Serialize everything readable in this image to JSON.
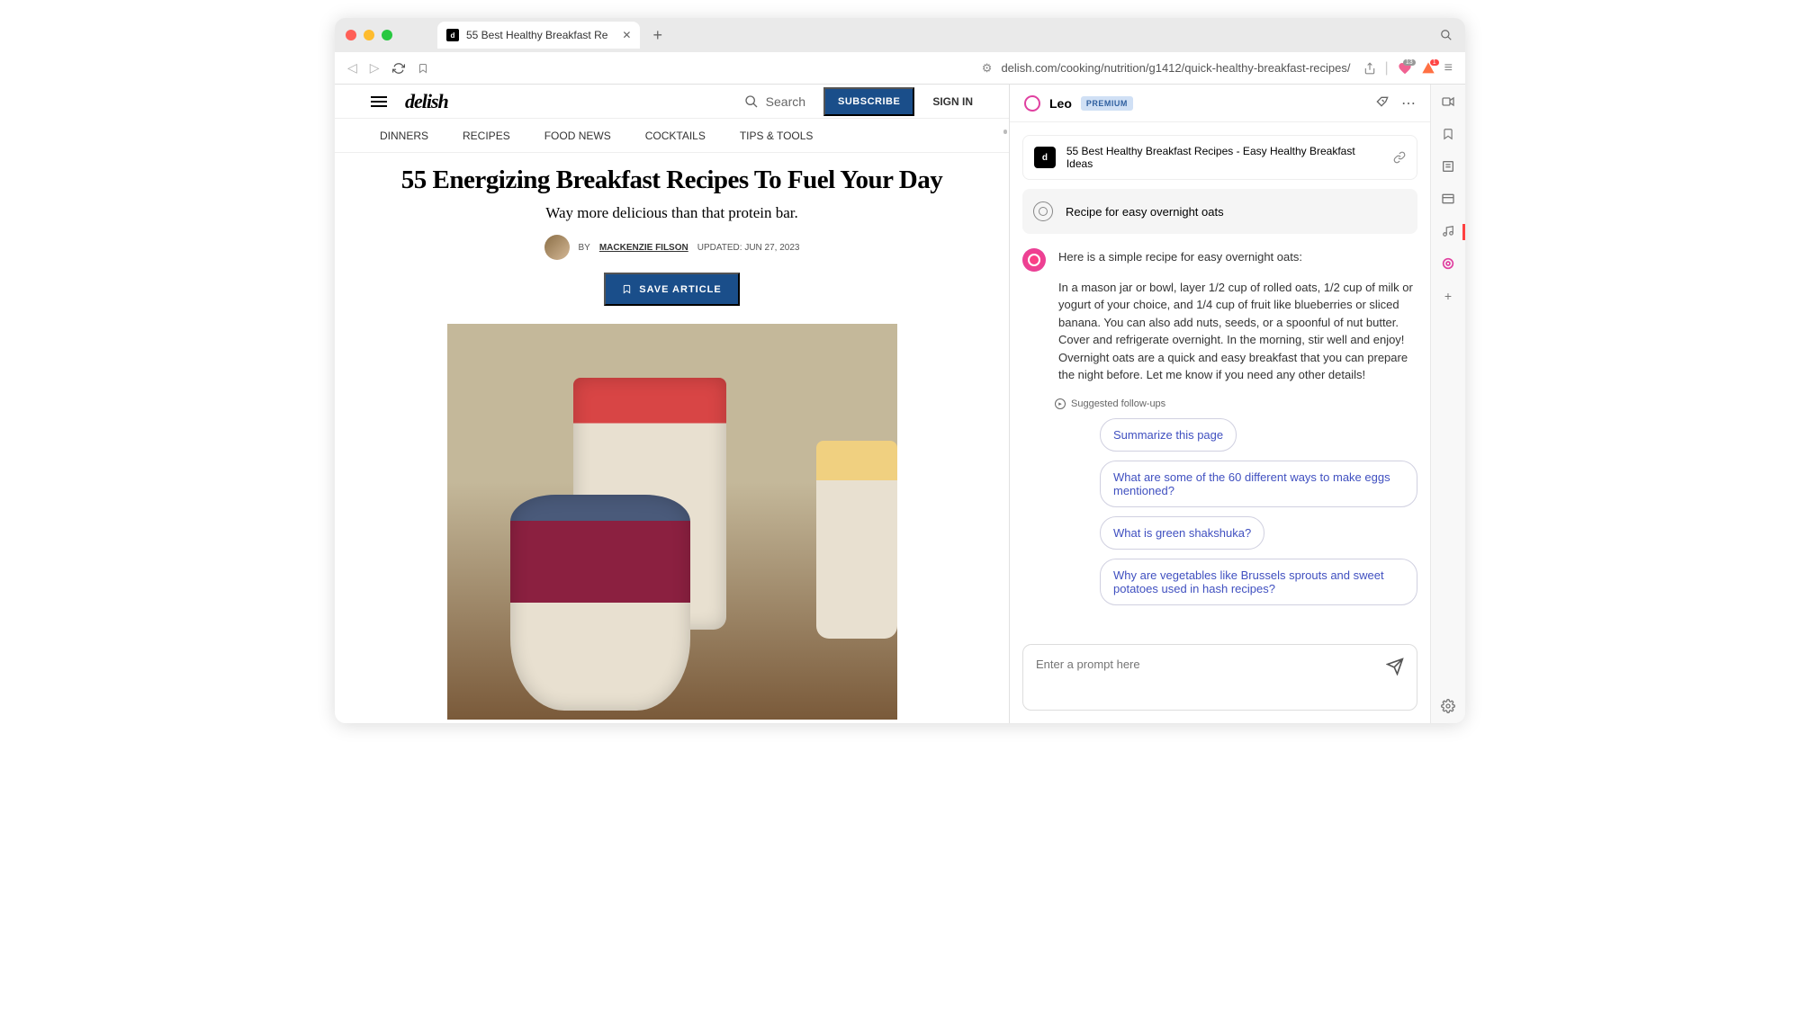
{
  "browser": {
    "tab_title": "55 Best Healthy Breakfast Re",
    "url": "delish.com/cooking/nutrition/g1412/quick-healthy-breakfast-recipes/",
    "shield_badge": "13"
  },
  "site": {
    "logo": "delish",
    "search_placeholder": "Search",
    "subscribe": "SUBSCRIBE",
    "signin": "SIGN IN",
    "nav": [
      "DINNERS",
      "RECIPES",
      "FOOD NEWS",
      "COCKTAILS",
      "TIPS & TOOLS"
    ]
  },
  "article": {
    "title": "55 Energizing Breakfast Recipes To Fuel Your Day",
    "subtitle": "Way more delicious than that protein bar.",
    "by_prefix": "BY",
    "author": "MACKENZIE FILSON",
    "updated": "UPDATED: JUN 27, 2023",
    "save": "SAVE ARTICLE"
  },
  "leo": {
    "name": "Leo",
    "badge": "PREMIUM",
    "context_title": "55 Best Healthy Breakfast Recipes - Easy Healthy Breakfast Ideas",
    "user_query": "Recipe for easy overnight oats",
    "ai_intro": "Here is a simple recipe for easy overnight oats:",
    "ai_body": "In a mason jar or bowl, layer 1/2 cup of rolled oats, 1/2 cup of milk or yogurt of your choice, and 1/4 cup of fruit like blueberries or sliced banana. You can also add nuts, seeds, or a spoonful of nut butter. Cover and refrigerate overnight. In the morning, stir well and enjoy! Overnight oats are a quick and easy breakfast that you can prepare the night before. Let me know if you need any other details!",
    "followups_label": "Suggested follow-ups",
    "followups": [
      "Summarize this page",
      "What are some of the 60 different ways to make eggs mentioned?",
      "What is green shakshuka?",
      "Why are vegetables like Brussels sprouts and sweet potatoes used in hash recipes?"
    ],
    "prompt_placeholder": "Enter a prompt here"
  }
}
